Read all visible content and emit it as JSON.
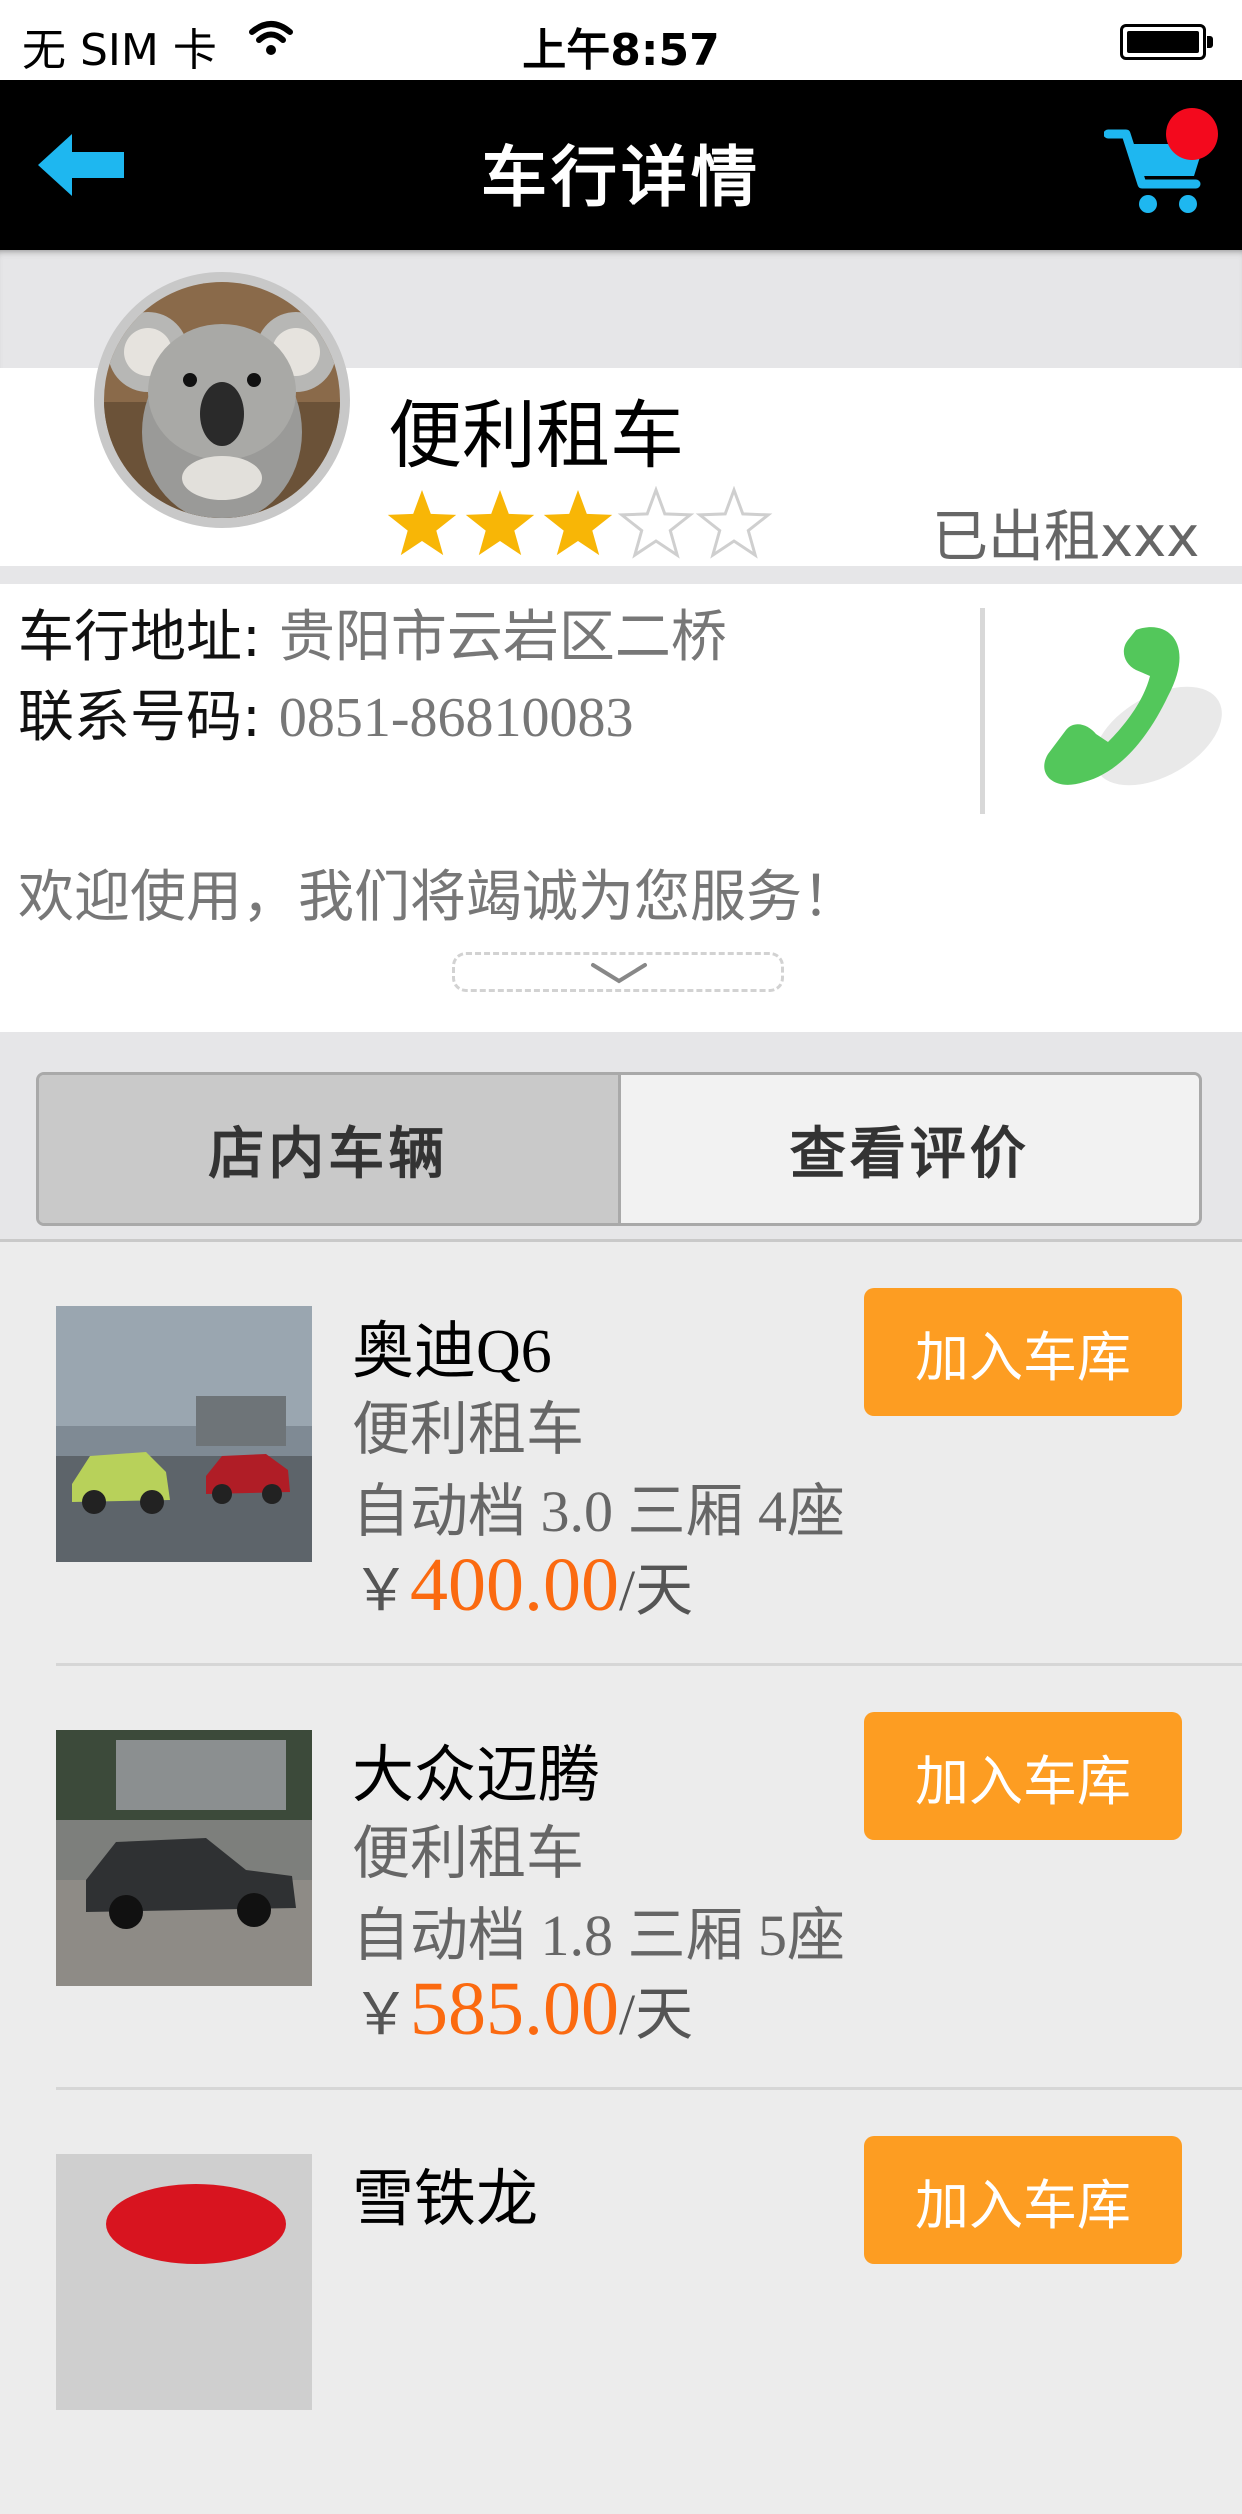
{
  "status_bar": {
    "carrier": "无 SIM 卡",
    "time": "上午8:57"
  },
  "nav": {
    "title": "车行详情"
  },
  "shop": {
    "name": "便利租车",
    "rating": 3,
    "rating_max": 5,
    "rented": "已出租xxx"
  },
  "info": {
    "address_label": "车行地址:",
    "address": "贵阳市云岩区二桥",
    "phone_label": "联系号码:",
    "phone": "0851-86810083",
    "welcome": "欢迎使用，我们将竭诚为您服务！"
  },
  "tabs": [
    {
      "label": "店内车辆",
      "active": true
    },
    {
      "label": "查看评价",
      "active": false
    }
  ],
  "cars": [
    {
      "name": "奥迪Q6",
      "shop": "便利租车",
      "spec": "自动档 3.0 三厢 4座",
      "currency": "￥",
      "price": "400.00",
      "unit": "/天",
      "button": "加入车库"
    },
    {
      "name": "大众迈腾",
      "shop": "便利租车",
      "spec": "自动档 1.8 三厢 5座",
      "currency": "￥",
      "price": "585.00",
      "unit": "/天",
      "button": "加入车库"
    },
    {
      "name": "雪铁龙",
      "button": "加入车库"
    }
  ],
  "colors": {
    "accent_orange": "#fd9d22",
    "price_orange": "#fb6a10",
    "nav_bg": "#000000",
    "icon_blue": "#1eb7f0",
    "badge_red": "#f3091d",
    "star_gold": "#f8b606"
  }
}
